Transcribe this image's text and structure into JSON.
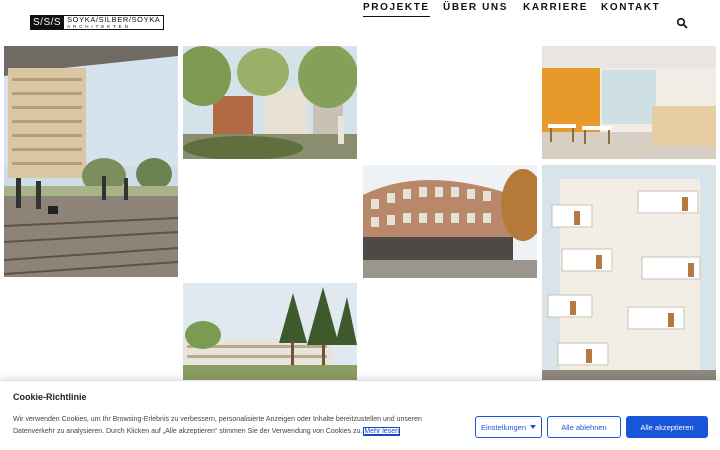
{
  "header": {
    "logo": {
      "mark": "S/S/S",
      "names": "SOYKA/SILBER/SOYKA",
      "subtitle": "ARCHITEKTEN"
    },
    "nav": [
      {
        "label": "PROJEKTE",
        "active": true
      },
      {
        "label": "ÜBER UNS",
        "active": false
      },
      {
        "label": "KARRIERE",
        "active": false
      },
      {
        "label": "KONTAKT",
        "active": false
      }
    ],
    "search_icon": "search-icon"
  },
  "gallery": {
    "tiles": [
      {
        "name": "project-tile-railway-housing",
        "subject": "residential blocks by railway tracks"
      },
      {
        "name": "project-tile-park-housing",
        "subject": "housing with park and trees"
      },
      {
        "name": "project-tile-interior-canteen",
        "subject": "interior with orange wall and tables"
      },
      {
        "name": "project-tile-curved-office",
        "subject": "curved brick office building"
      },
      {
        "name": "project-tile-white-apartments",
        "subject": "white apartment block with balconies"
      },
      {
        "name": "project-tile-forest-campus",
        "subject": "building among pine trees"
      }
    ]
  },
  "cookie_banner": {
    "title": "Cookie-Richtlinie",
    "text_line1": "Wir verwenden Cookies, um Ihr Browsing-Erlebnis zu verbessern, personalisierte Anzeigen oder Inhalte bereitzustellen und unseren",
    "text_line2": "Datenverkehr zu analysieren. Durch Klicken auf „Alle akzeptieren“ stimmen Sie der Verwendung von Cookies zu.",
    "link_label": "Mehr lesen",
    "buttons": {
      "settings": "Einstellungen",
      "reject": "Alle ablehnen",
      "accept": "Alle akzeptieren"
    },
    "colors": {
      "accent": "#1a56db"
    }
  }
}
